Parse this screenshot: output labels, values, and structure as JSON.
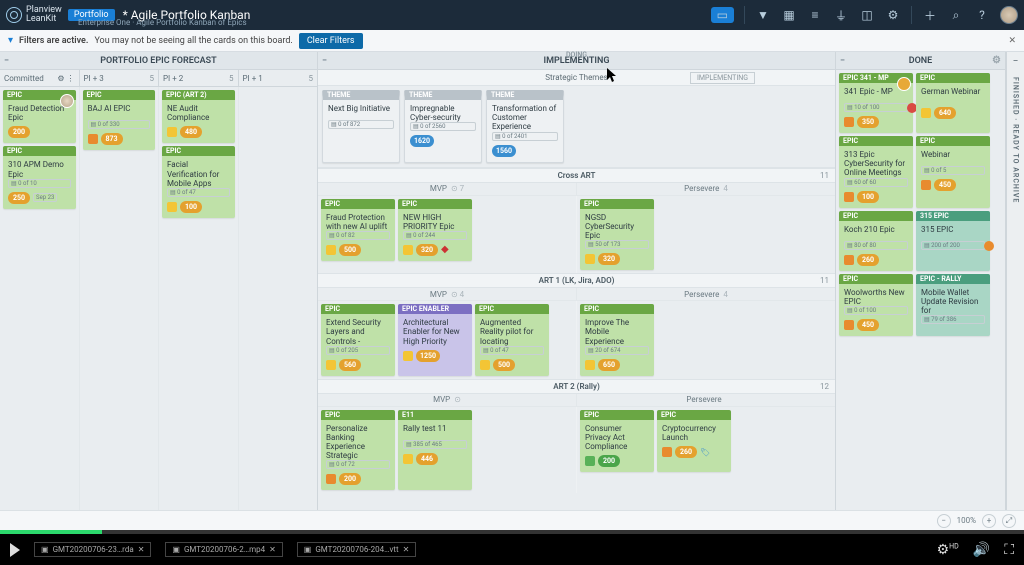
{
  "header": {
    "brand_line1": "Planview",
    "brand_line2": "LeanKit",
    "badge": "Portfolio",
    "title": "* Agile Portfolio Kanban",
    "subtitle": "Enterprise One · Agile Portfolio Kanban of Epics"
  },
  "filterbar": {
    "strong": "Filters are active.",
    "msg": "You may not be seeing all the cards on this board.",
    "clear": "Clear Filters"
  },
  "lanes": {
    "forecast": {
      "title": "PORTFOLIO EPIC FORECAST",
      "sublanes": [
        {
          "label": "Committed",
          "count": ""
        },
        {
          "label": "PI + 3",
          "count": "5"
        },
        {
          "label": "PI + 2",
          "count": "5"
        },
        {
          "label": "PI + 1",
          "count": "5"
        }
      ]
    },
    "implementing": {
      "title": "IMPLEMENTING",
      "doing": "DOING"
    },
    "done": {
      "title": "DONE"
    },
    "finished": {
      "title": "FINISHED · READY TO ARCHIVE"
    }
  },
  "themes": {
    "header": "Strategic Themes",
    "tab": "IMPLEMENTING",
    "cards": [
      {
        "type": "THEME",
        "title": "Next Big Initiative",
        "meta": "0 of 872"
      },
      {
        "type": "THEME",
        "title": "Impregnable Cyber-security",
        "meta": "0 of 2560",
        "pill": "1620"
      },
      {
        "type": "THEME",
        "title": "Transformation of Customer Experience",
        "meta": "0 of 2401",
        "pill": "1560"
      }
    ]
  },
  "rows": [
    {
      "name": "Cross ART",
      "count": "11",
      "sub": [
        {
          "n": "MVP",
          "c": "7"
        },
        {
          "n": "Persevere",
          "c": "4"
        }
      ],
      "mvp": [
        {
          "type": "EPIC",
          "title": "Fraud Protection with new AI uplift",
          "meta": "0 of 82",
          "pill": "500",
          "chip": "y"
        },
        {
          "type": "EPIC",
          "title": "NEW HIGH PRIORITY Epic",
          "meta": "0 of 244",
          "pill": "320",
          "chip": "y",
          "warn": true
        }
      ],
      "pers": [
        {
          "type": "EPIC",
          "title": "NGSD CyberSecurity Epic",
          "meta": "50 of 173",
          "pill": "320",
          "chip": "y"
        }
      ]
    },
    {
      "name": "ART 1 (LK, Jira, ADO)",
      "count": "11",
      "sub": [
        {
          "n": "MVP",
          "c": "4"
        },
        {
          "n": "Persevere",
          "c": "4"
        }
      ],
      "mvp": [
        {
          "type": "EPIC",
          "title": "Extend Security Layers and Controls -",
          "meta": "0 of 205",
          "pill": "560",
          "chip": "y",
          "cls": "green"
        },
        {
          "type": "EPIC ENABLER",
          "title": "Architectural Enabler for New High Priority",
          "meta": "",
          "pill": "1250",
          "chip": "y",
          "cls": "purple"
        },
        {
          "type": "EPIC",
          "title": "Augmented Reality pilot for locating",
          "meta": "0 of 47",
          "pill": "500",
          "chip": "y",
          "cls": "green"
        }
      ],
      "pers": [
        {
          "type": "EPIC",
          "title": "Improve The Mobile Experience",
          "meta": "20 of 674",
          "pill": "650",
          "chip": "y",
          "cls": "green"
        }
      ]
    },
    {
      "name": "ART 2 (Rally)",
      "count": "12",
      "sub": [
        {
          "n": "MVP",
          "c": ""
        },
        {
          "n": "Persevere",
          "c": ""
        }
      ],
      "mvp": [
        {
          "type": "EPIC",
          "title": "Personalize Banking Experience Strategic",
          "meta": "0 of 72",
          "pill": "200",
          "chip": "o",
          "cls": "green"
        },
        {
          "type": "E11",
          "title": "Rally test 11",
          "meta": "385 of 465",
          "pill": "446",
          "chip": "y",
          "cls": "green"
        }
      ],
      "pers": [
        {
          "type": "EPIC",
          "title": "Consumer Privacy Act Compliance",
          "meta": "",
          "pill": "200",
          "chip": "g",
          "cls": "green"
        },
        {
          "type": "EPIC",
          "title": "Cryptocurrency Launch",
          "meta": "",
          "pill": "260",
          "chip": "o",
          "cls": "green",
          "tag": true
        }
      ]
    }
  ],
  "forecast_cards": {
    "committed": [
      {
        "type": "EPIC",
        "title": "Fraud Detection Epic",
        "pill": "200",
        "avatar": true
      },
      {
        "type": "EPIC",
        "title": "310 APM Demo Epic",
        "meta": "0 of 10",
        "pill": "250",
        "date": "Sep 23"
      }
    ],
    "pi3": [
      {
        "type": "EPIC",
        "title": "BAJ AI EPIC",
        "meta": "0 of 330",
        "pill": "873",
        "chip": "o"
      }
    ],
    "pi2": [
      {
        "type": "EPIC (ART 2)",
        "title": "NE Audit Compliance",
        "meta": "",
        "pill": "480",
        "chip": "y"
      },
      {
        "type": "EPIC",
        "title": "Facial Verification for Mobile Apps",
        "meta": "0 of 47",
        "pill": "100",
        "chip": "y"
      }
    ],
    "pi1": []
  },
  "done_cards": [
    [
      {
        "type": "EPIC 341 - MP",
        "title": "341 Epic - MP",
        "meta": "10 of 100",
        "pill": "350",
        "chip": "o",
        "avatar": "amber",
        "dot": "red"
      },
      {
        "type": "EPIC",
        "title": "German Webinar",
        "meta": "",
        "pill": "640",
        "chip": "y"
      }
    ],
    [
      {
        "type": "EPIC",
        "title": "313 Epic CyberSecurity for Online Meetings",
        "meta": "60 of 60",
        "pill": "100",
        "chip": "o"
      },
      {
        "type": "EPIC",
        "title": "Webinar",
        "meta": "0 of 5",
        "pill": "450",
        "chip": "o"
      }
    ],
    [
      {
        "type": "EPIC",
        "title": "Koch 210 Epic",
        "meta": "80 of 80",
        "pill": "260",
        "chip": "o"
      },
      {
        "type": "315 EPIC",
        "title": "315 EPIC",
        "meta": "200 of 200",
        "chip": "",
        "dot": "orange"
      }
    ],
    [
      {
        "type": "EPIC",
        "title": "Woolworths New EPIC",
        "meta": "0 of 100",
        "pill": "450",
        "chip": "o"
      },
      {
        "type": "EPIC - RALLY",
        "title": "Mobile Wallet Update Revision for",
        "meta": "79 of 386",
        "chip": "",
        "icons": true
      }
    ]
  ],
  "zoom": {
    "pct": "100%"
  },
  "player": {
    "files": [
      "GMT20200706-23…rda",
      "GMT20200706-2…mp4",
      "GMT20200706-204…vtt"
    ],
    "hd": "HD"
  }
}
